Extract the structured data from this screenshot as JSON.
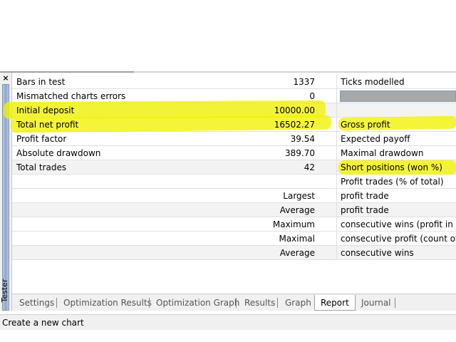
{
  "panel": {
    "close_symbol": "×",
    "side_label": "Tester"
  },
  "report": {
    "rows": [
      {
        "label": "Bars in test",
        "value": "1337",
        "right": "Ticks modelled"
      },
      {
        "label": "Mismatched charts errors",
        "value": "0",
        "right": ""
      },
      {
        "label": "Initial deposit",
        "value": "10000.00",
        "right": ""
      },
      {
        "label": "Total net profit",
        "value": "16502.27",
        "right": "Gross profit"
      },
      {
        "label": "Profit factor",
        "value": "39.54",
        "right": "Expected payoff"
      },
      {
        "label": "Absolute drawdown",
        "value": "389.70",
        "right": "Maximal drawdown"
      },
      {
        "label": "Total trades",
        "value": "42",
        "right": "Short positions (won %)"
      },
      {
        "label": "",
        "value": "",
        "right": "Profit trades (% of total)"
      },
      {
        "label": "",
        "value": "Largest",
        "right": "profit trade"
      },
      {
        "label": "",
        "value": "Average",
        "right": "profit trade"
      },
      {
        "label": "",
        "value": "Maximum",
        "right": "consecutive wins (profit in money)"
      },
      {
        "label": "",
        "value": "Maximal",
        "right": "consecutive profit (count of wins)"
      },
      {
        "label": "",
        "value": "Average",
        "right": "consecutive wins"
      }
    ]
  },
  "tabs": [
    "Settings",
    "Optimization Results",
    "Optimization Graph",
    "Results",
    "Graph",
    "Report",
    "Journal"
  ],
  "active_tab": "Report",
  "status": {
    "text": "Create a new chart"
  },
  "colors": {
    "highlight": "#f2f200",
    "tab_bg": "#f0f0f0",
    "progress_bar": "#a8a8a8"
  }
}
